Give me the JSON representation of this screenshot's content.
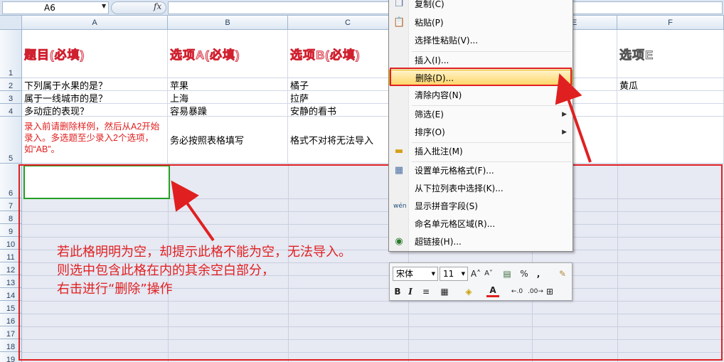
{
  "formula_bar": {
    "name_box": "A6",
    "fx": "fx",
    "value": ""
  },
  "columns": [
    "A",
    "B",
    "C",
    "D",
    "E",
    "F"
  ],
  "rows": [
    "1",
    "2",
    "3",
    "4",
    "5",
    "6",
    "7",
    "8",
    "9",
    "10",
    "11",
    "12",
    "13",
    "14",
    "15",
    "16",
    "17",
    "18",
    "19"
  ],
  "header_cells": {
    "a1": "题目(必填)",
    "b1": "选项A(必填)",
    "c1": "选项B(必填)",
    "f1": "选项E"
  },
  "data_cells": {
    "a2": "下列属于水果的是？",
    "b2": "苹果",
    "c2": "橘子",
    "f2": "黄瓜",
    "a3": "属于一线城市的是？",
    "b3": "上海",
    "c3": "拉萨",
    "a4": "多动症的表现？",
    "b4": "容易暴躁",
    "c4": "安静的看书",
    "a5": "录入前请删除样例，然后从A2开始录入。多选题至少录入2个选项，如“AB”。",
    "b5": "务必按照表格填写",
    "c5": "格式不对将无法导入"
  },
  "context_menu": {
    "items": [
      {
        "label": "复制(C)",
        "icon": "copy-icon"
      },
      {
        "label": "粘贴(P)",
        "icon": "paste-icon"
      },
      {
        "label": "选择性粘贴(V)...",
        "icon": ""
      },
      {
        "label": "插入(I)...",
        "icon": ""
      },
      {
        "label": "删除(D)...",
        "icon": "",
        "highlighted": true
      },
      {
        "label": "清除内容(N)",
        "icon": ""
      },
      {
        "label": "筛选(E)",
        "icon": "",
        "submenu": true
      },
      {
        "label": "排序(O)",
        "icon": "",
        "submenu": true
      },
      {
        "label": "插入批注(M)",
        "icon": "comment-icon"
      },
      {
        "label": "设置单元格格式(F)...",
        "icon": "format-cells-icon"
      },
      {
        "label": "从下拉列表中选择(K)...",
        "icon": ""
      },
      {
        "label": "显示拼音字段(S)",
        "icon": "phonetic-icon"
      },
      {
        "label": "命名单元格区域(R)...",
        "icon": ""
      },
      {
        "label": "超链接(H)...",
        "icon": "hyperlink-icon"
      }
    ]
  },
  "mini_toolbar": {
    "font": "宋体",
    "size": "11",
    "percent": "%",
    "comma": ",",
    "bold": "B",
    "italic": "I",
    "font_color_letter": "A"
  },
  "annotation": {
    "line1": "若此格明明为空，却提示此格不能为空，无法导入。",
    "line2": "则选中包含此格在内的其余空白部分，",
    "line3": "右击进行“删除”操作"
  },
  "colors": {
    "highlight_red": "#e02020",
    "selection_green": "#25a025",
    "menu_highlight": "#ffd66b"
  }
}
